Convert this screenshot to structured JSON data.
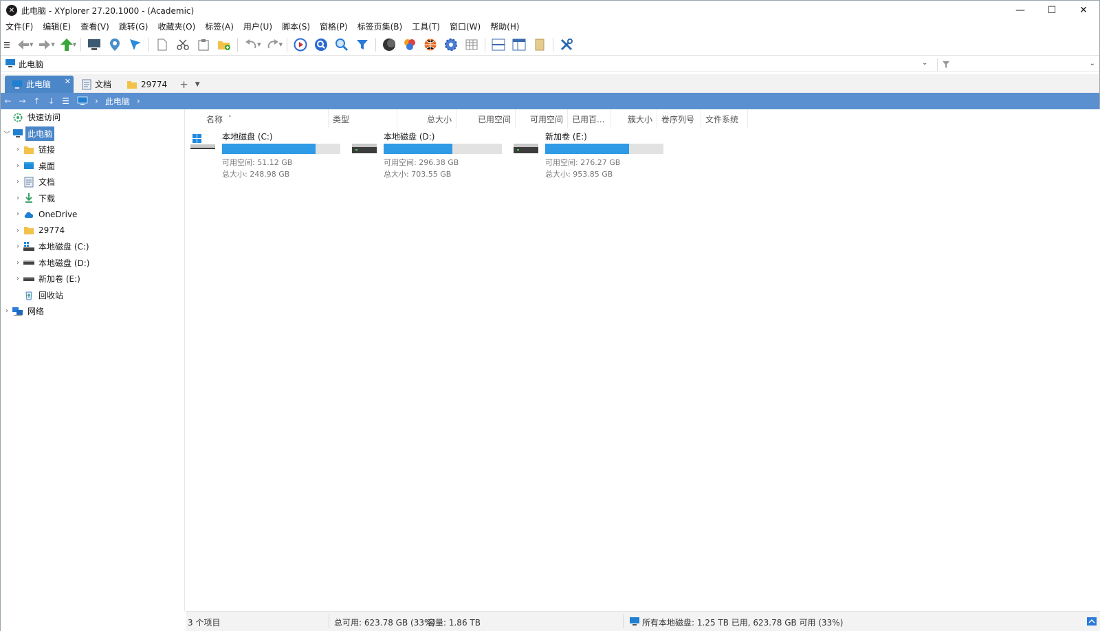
{
  "window": {
    "title": "此电脑 - XYplorer 27.20.1000 - (Academic)",
    "controls": {
      "minimize": "—",
      "maximize": "☐",
      "close": "✕"
    }
  },
  "menu": [
    "文件(F)",
    "编辑(E)",
    "查看(V)",
    "跳转(G)",
    "收藏夹(O)",
    "标签(A)",
    "用户(U)",
    "脚本(S)",
    "窗格(P)",
    "标签页集(B)",
    "工具(T)",
    "窗口(W)",
    "帮助(H)"
  ],
  "address": {
    "path": "此电脑"
  },
  "tabs": [
    {
      "label": "此电脑",
      "active": true
    },
    {
      "label": "文档",
      "active": false
    },
    {
      "label": "29774",
      "active": false
    }
  ],
  "tab_add": "+",
  "breadcrumb": {
    "current": "此电脑"
  },
  "tree": [
    {
      "label": "快速访问",
      "icon": "gear-icon",
      "level": 0,
      "expander": "",
      "selected": false
    },
    {
      "label": "此电脑",
      "icon": "computer-icon",
      "level": 0,
      "expander": "﹀",
      "selected": true
    },
    {
      "label": "链接",
      "icon": "folder-icon",
      "level": 1,
      "expander": "›",
      "selected": false
    },
    {
      "label": "桌面",
      "icon": "desktop-icon",
      "level": 1,
      "expander": "›",
      "selected": false
    },
    {
      "label": "文档",
      "icon": "document-icon",
      "level": 1,
      "expander": "›",
      "selected": false
    },
    {
      "label": "下载",
      "icon": "download-icon",
      "level": 1,
      "expander": "›",
      "selected": false
    },
    {
      "label": "OneDrive",
      "icon": "cloud-icon",
      "level": 1,
      "expander": "›",
      "selected": false
    },
    {
      "label": "29774",
      "icon": "folder-icon",
      "level": 1,
      "expander": "›",
      "selected": false
    },
    {
      "label": "本地磁盘 (C:)",
      "icon": "system-drive-icon",
      "level": 1,
      "expander": "›",
      "selected": false
    },
    {
      "label": "本地磁盘 (D:)",
      "icon": "drive-icon",
      "level": 1,
      "expander": "›",
      "selected": false
    },
    {
      "label": "新加卷 (E:)",
      "icon": "drive-icon",
      "level": 1,
      "expander": "›",
      "selected": false
    },
    {
      "label": "回收站",
      "icon": "recycle-bin-icon",
      "level": 1,
      "expander": "",
      "selected": false
    },
    {
      "label": "网络",
      "icon": "network-icon",
      "level": 0,
      "expander": "›",
      "selected": false
    }
  ],
  "columns": [
    "名称",
    "类型",
    "总大小",
    "已用空间",
    "可用空间",
    "已用百...",
    "簇大小",
    "卷序列号",
    "文件系统"
  ],
  "sort_indicator": "˄",
  "drives": [
    {
      "name": "本地磁盘 (C:)",
      "free": "可用空间: 51.12 GB",
      "total": "总大小: 248.98 GB",
      "used_fraction": 0.79,
      "system": true
    },
    {
      "name": "本地磁盘 (D:)",
      "free": "可用空间: 296.38 GB",
      "total": "总大小: 703.55 GB",
      "used_fraction": 0.58,
      "system": false
    },
    {
      "name": "新加卷 (E:)",
      "free": "可用空间: 276.27 GB",
      "total": "总大小: 953.85 GB",
      "used_fraction": 0.71,
      "system": false
    }
  ],
  "status": {
    "items": "3 个项目",
    "free_total": "总可用: 623.78 GB (33%)",
    "capacity": "容量: 1.86 TB",
    "all_drives": "所有本地磁盘: 1.25 TB 已用, 623.78 GB 可用 (33%)"
  },
  "colors": {
    "accent": "#4a86c8",
    "breadcrumb_bg": "#5a8fd0",
    "drive_bar_fill": "#2f9ae6",
    "drive_bar_bg": "#e2e2e2"
  }
}
